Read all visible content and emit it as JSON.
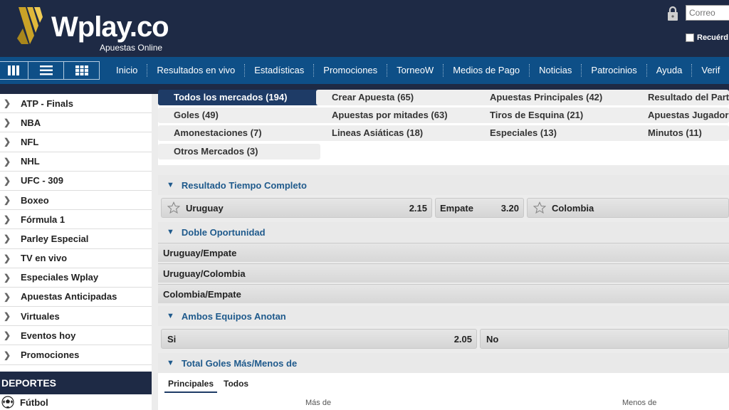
{
  "header": {
    "logo_text": "Wplay.co",
    "logo_subtitle": "Apuestas Online",
    "email_placeholder": "Correo",
    "remember_label": "Recuérd"
  },
  "nav": {
    "items": [
      "Inicio",
      "Resultados en vivo",
      "Estadísticas",
      "Promociones",
      "TorneoW",
      "Medios de Pago",
      "Noticias",
      "Patrocinios",
      "Ayuda",
      "Verif"
    ]
  },
  "sidebar": {
    "items": [
      "ATP - Finals",
      "NBA",
      "NFL",
      "NHL",
      "UFC - 309",
      "Boxeo",
      "Fórmula 1",
      "Parley Especial",
      "TV en vivo",
      "Especiales Wplay",
      "Apuestas Anticipadas",
      "Virtuales",
      "Eventos hoy",
      "Promociones"
    ],
    "section_header": "DEPORTES",
    "sport": "Fútbol"
  },
  "markets": [
    {
      "label": "Todos los mercados (194)",
      "active": true
    },
    {
      "label": "Crear Apuesta (65)"
    },
    {
      "label": "Apuestas Principales (42)"
    },
    {
      "label": "Resultado del Parti"
    },
    {
      "label": "Goles (49)"
    },
    {
      "label": "Apuestas por mitades (63)"
    },
    {
      "label": "Tiros de Esquina (21)"
    },
    {
      "label": "Apuestas Jugador"
    },
    {
      "label": "Amonestaciones (7)"
    },
    {
      "label": "Lineas Asiáticas (18)"
    },
    {
      "label": "Especiales (13)"
    },
    {
      "label": "Minutos (11)"
    },
    {
      "label": "Otros Mercados (3)"
    }
  ],
  "sections": {
    "resultado": {
      "title": "Resultado Tiempo Completo",
      "home": {
        "name": "Uruguay",
        "odd": "2.15"
      },
      "draw": {
        "name": "Empate",
        "odd": "3.20"
      },
      "away": {
        "name": "Colombia"
      }
    },
    "doble": {
      "title": "Doble Oportunidad",
      "rows": [
        "Uruguay/Empate",
        "Uruguay/Colombia",
        "Colombia/Empate"
      ]
    },
    "ambos": {
      "title": "Ambos Equipos Anotan",
      "yes": {
        "name": "Si",
        "odd": "2.05"
      },
      "no": {
        "name": "No"
      }
    },
    "total": {
      "title": "Total Goles Más/Menos de",
      "tabs": [
        "Principales",
        "Todos"
      ],
      "col_over": "Más de",
      "col_under": "Menos de"
    }
  },
  "colors": {
    "header_bg": "#1e2a45",
    "nav_bg": "#0e4f87",
    "accent_text": "#1f5a8c",
    "active_market": "#1e3b66",
    "logo_gold": "#c9a227"
  }
}
